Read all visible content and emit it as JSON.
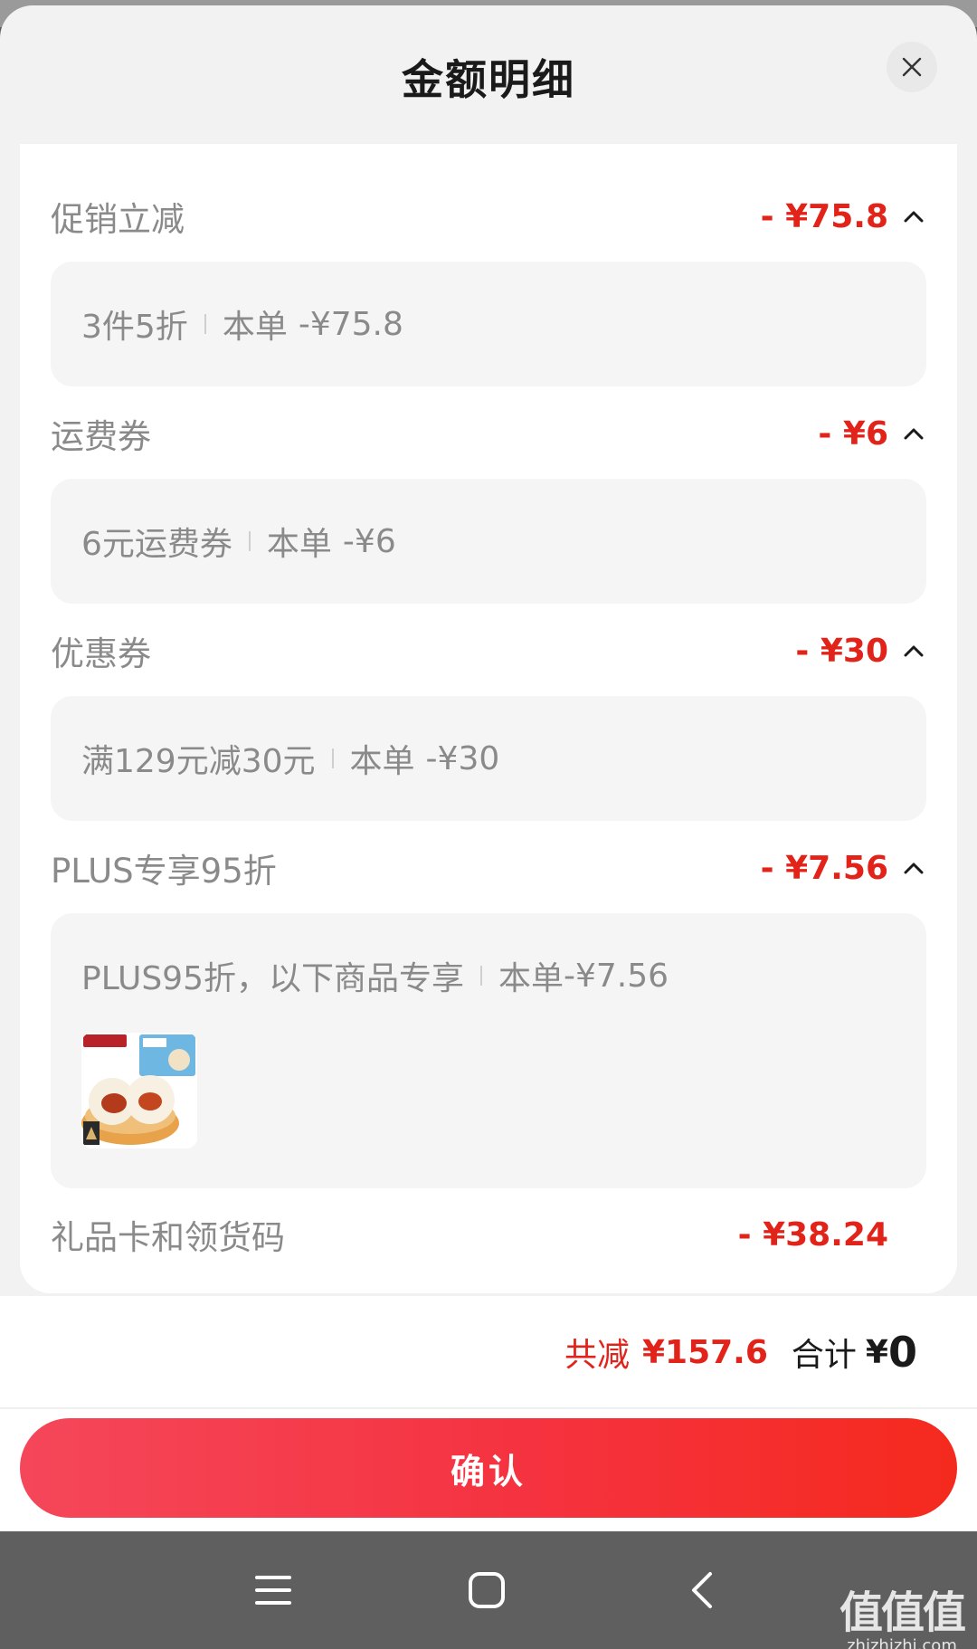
{
  "sheet": {
    "title": "金额明细",
    "close_icon": "close-icon"
  },
  "sections": [
    {
      "label": "促销立减",
      "amount": "- ¥75.8",
      "detail": {
        "name": "3件5折",
        "order_label": "本单",
        "order_amount": "-¥75.8"
      }
    },
    {
      "label": "运费券",
      "amount": "- ¥6",
      "detail": {
        "name": "6元运费券",
        "order_label": "本单",
        "order_amount": "-¥6"
      }
    },
    {
      "label": "优惠券",
      "amount": "- ¥30",
      "detail": {
        "name": "满129元减30元",
        "order_label": "本单",
        "order_amount": "-¥30"
      }
    },
    {
      "label": "PLUS专享95折",
      "amount": "- ¥7.56",
      "detail": {
        "name": "PLUS95折，以下商品专享",
        "order_label": "本单",
        "order_amount": "-¥7.56"
      }
    },
    {
      "label": "礼品卡和领货码",
      "amount": "- ¥38.24"
    }
  ],
  "totals": {
    "saved_label": "共减",
    "saved_value": "¥157.6",
    "sum_label": "合计",
    "sum_currency": "¥",
    "sum_value": "0"
  },
  "confirm": {
    "label": "确认"
  },
  "colors": {
    "accent": "#e2231a",
    "confirm_start": "#f5475a",
    "confirm_end": "#f52a1e"
  },
  "navbar": {
    "icons": [
      "menu-icon",
      "home-icon",
      "back-icon"
    ]
  },
  "watermark": {
    "mark": "值值值",
    "url": "zhizhizhi.com"
  }
}
